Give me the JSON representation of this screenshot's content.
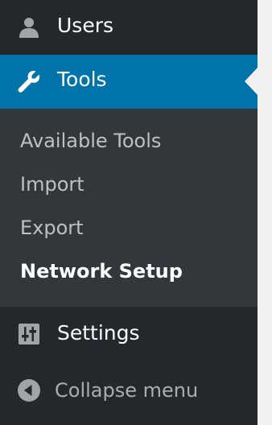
{
  "menu": {
    "users": {
      "label": "Users",
      "icon": "user-icon"
    },
    "tools": {
      "label": "Tools",
      "icon": "wrench-icon",
      "active": true
    },
    "tools_submenu": [
      {
        "label": "Available Tools"
      },
      {
        "label": "Import"
      },
      {
        "label": "Export"
      },
      {
        "label": "Network Setup",
        "current": true
      }
    ],
    "settings": {
      "label": "Settings",
      "icon": "settings-sliders-icon"
    },
    "collapse": {
      "label": "Collapse menu",
      "icon": "collapse-arrow-icon"
    }
  },
  "colors": {
    "sidebar_bg": "#23282d",
    "submenu_bg": "#32373c",
    "active_bg": "#0073aa",
    "page_bg": "#f1f1f1",
    "text_white": "#ffffff",
    "icon_gray": "#a0a5aa"
  }
}
